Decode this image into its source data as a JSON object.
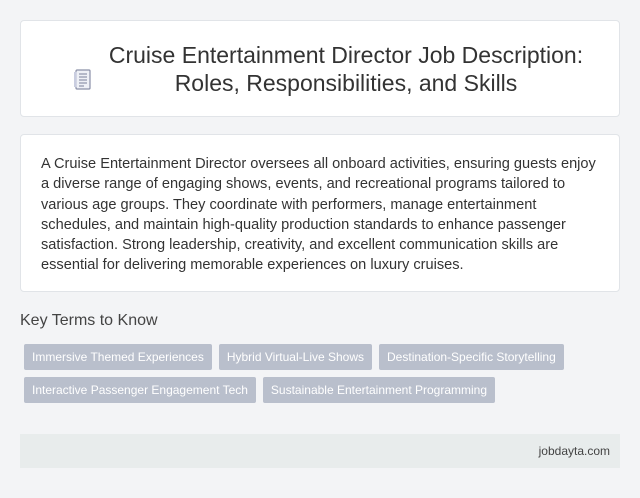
{
  "header": {
    "title": "Cruise Entertainment Director Job Description: Roles, Responsibilities, and Skills",
    "icon": "document-icon"
  },
  "description": {
    "text": "A Cruise Entertainment Director oversees all onboard activities, ensuring guests enjoy a diverse range of engaging shows, events, and recreational programs tailored to various age groups. They coordinate with performers, manage entertainment schedules, and maintain high-quality production standards to enhance passenger satisfaction. Strong leadership, creativity, and excellent communication skills are essential for delivering memorable experiences on luxury cruises."
  },
  "key_terms": {
    "heading": "Key Terms to Know",
    "tags": [
      "Immersive Themed Experiences",
      "Hybrid Virtual-Live Shows",
      "Destination-Specific Storytelling",
      "Interactive Passenger Engagement Tech",
      "Sustainable Entertainment Programming"
    ]
  },
  "footer": {
    "site": "jobdayta.com"
  },
  "colors": {
    "background": "#f3f4f6",
    "card": "#ffffff",
    "tag_bg": "#b9bfcc",
    "footer_bg": "#e8ecec"
  }
}
